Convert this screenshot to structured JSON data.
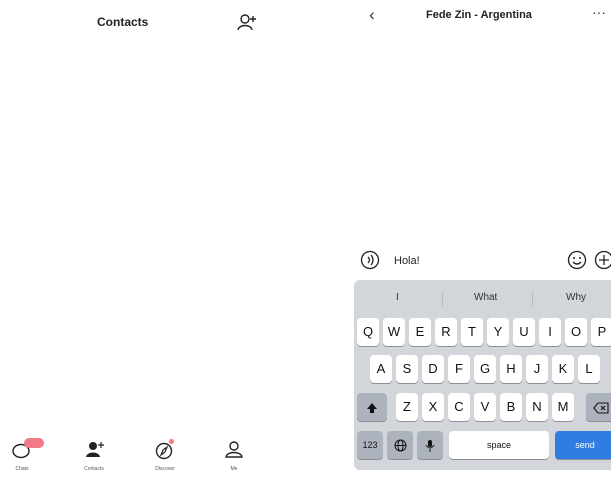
{
  "contacts_screen": {
    "title": "Contacts",
    "add_icon": "add-contact-icon",
    "tabs": [
      {
        "name": "chats",
        "icon": "chat-bubble-icon",
        "label": "Chats",
        "badge": true
      },
      {
        "name": "contacts",
        "icon": "contacts-icon",
        "label": "Contacts"
      },
      {
        "name": "discover",
        "icon": "compass-icon",
        "label": "Discover",
        "dot": true
      },
      {
        "name": "me",
        "icon": "person-icon",
        "label": "Me"
      }
    ]
  },
  "chat_screen": {
    "back_label": "‹",
    "title": "Fede Zin - Argentina",
    "more_label": "···",
    "input": {
      "value": "Hola!"
    },
    "keyboard": {
      "suggestions": [
        "I",
        "What",
        "Why"
      ],
      "row1": [
        "Q",
        "W",
        "E",
        "R",
        "T",
        "Y",
        "U",
        "I",
        "O",
        "P"
      ],
      "row2": [
        "A",
        "S",
        "D",
        "F",
        "G",
        "H",
        "J",
        "K",
        "L"
      ],
      "row3": [
        "Z",
        "X",
        "C",
        "V",
        "B",
        "N",
        "M"
      ],
      "numbers_label": "123",
      "space_label": "space",
      "send_label": "send"
    }
  },
  "colors": {
    "badge": "#f07b86",
    "send": "#2f7de1",
    "keyboard_bg": "#d2d5da"
  }
}
